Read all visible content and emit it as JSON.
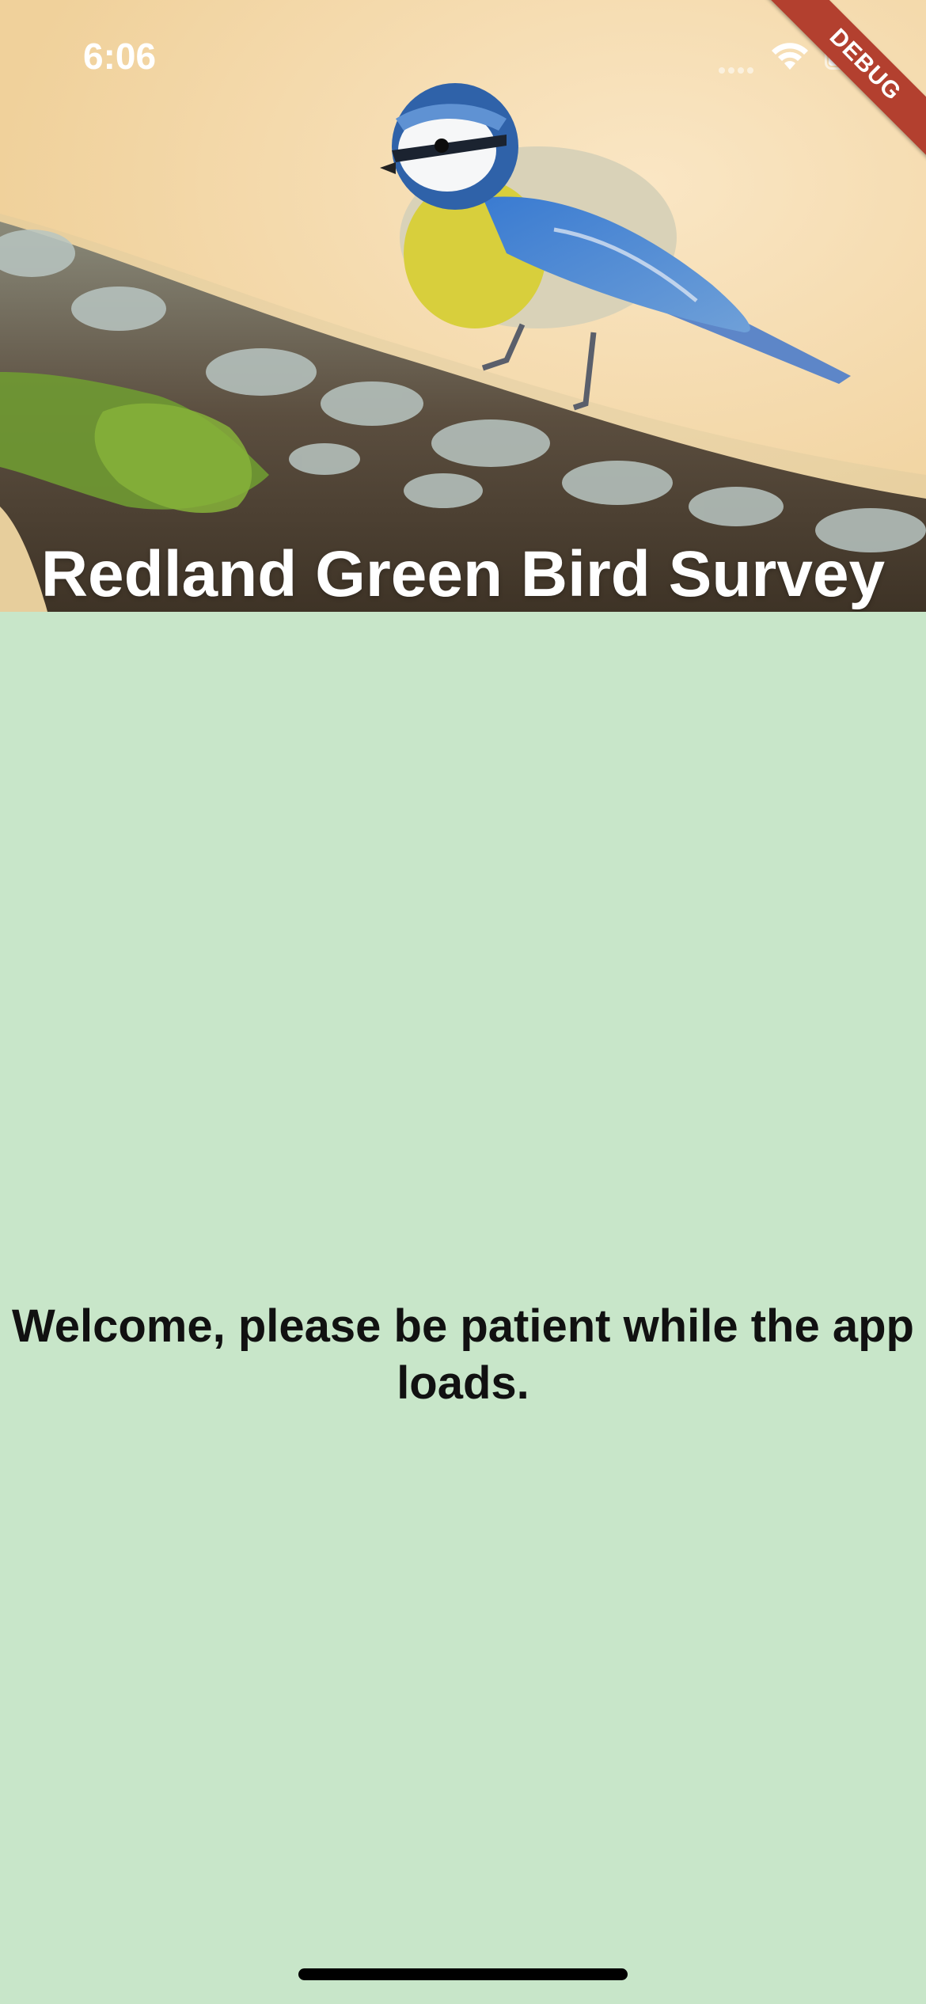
{
  "status_bar": {
    "time": "6:06"
  },
  "debug_banner": {
    "label": "DEBUG"
  },
  "header": {
    "title": "Redland Green Bird Survey",
    "image_subject": "blue-tit-on-branch"
  },
  "main": {
    "welcome_message": "Welcome, please be patient while the app loads."
  },
  "colors": {
    "background": "#c8e6c9",
    "title_text": "#ffffff",
    "message_text": "#111111",
    "debug_banner": "#b3402f"
  }
}
